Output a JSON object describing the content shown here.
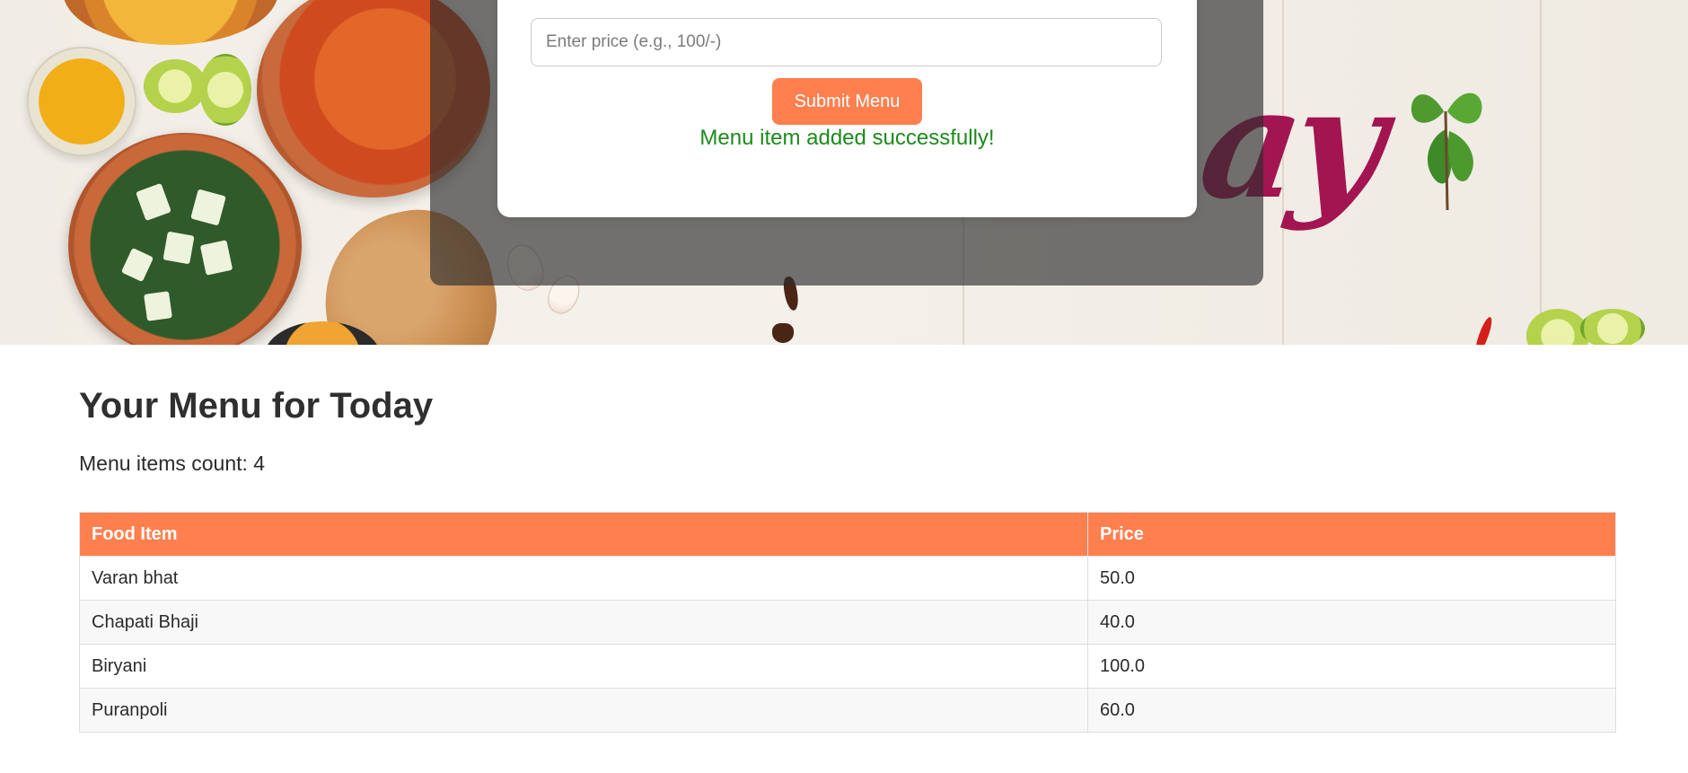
{
  "form": {
    "price_placeholder": "Enter price (e.g., 100/-)",
    "price_value": "",
    "submit_label": "Submit Menu",
    "success_message": "Menu item added successfully!"
  },
  "menu": {
    "title": "Your Menu for Today",
    "count_text": "Menu items count: 4",
    "columns": [
      "Food Item",
      "Price"
    ],
    "rows": [
      {
        "food": "Varan bhat",
        "price": "50.0"
      },
      {
        "food": "Chapati Bhaji",
        "price": "40.0"
      },
      {
        "food": "Biryani",
        "price": "100.0"
      },
      {
        "food": "Puranpoli",
        "price": "60.0"
      }
    ]
  },
  "colors": {
    "accent": "#ff7f4f",
    "success": "#1d8a1d",
    "brush_text": "#a31550"
  },
  "hero": {
    "brush_text": "ay"
  }
}
